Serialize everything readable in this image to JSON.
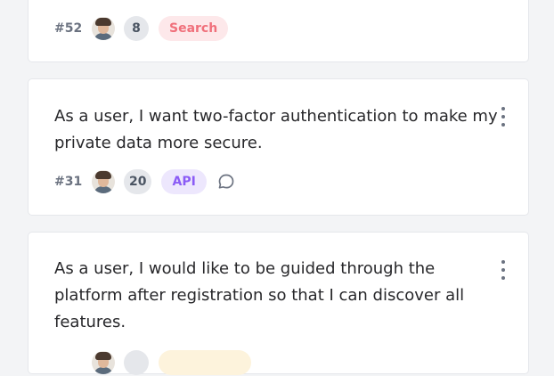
{
  "cards": [
    {
      "id": "#52",
      "points": "8",
      "tag": {
        "label": "Search",
        "bg": "#fde8ea",
        "color": "#f0707b"
      }
    },
    {
      "story": "As a user, I want two-factor authentication to make my private data more secure.",
      "id": "#31",
      "points": "20",
      "tag": {
        "label": "API",
        "bg": "#ede7fd",
        "color": "#8b5cf6"
      },
      "icons": [
        "comment-icon"
      ]
    },
    {
      "story": "As a user, I would like to be guided through the platform after registration so that I can discover all features.",
      "tag": {
        "bg": "#fdf3dc"
      }
    }
  ],
  "icons": {
    "menu": "more-vertical-icon"
  }
}
